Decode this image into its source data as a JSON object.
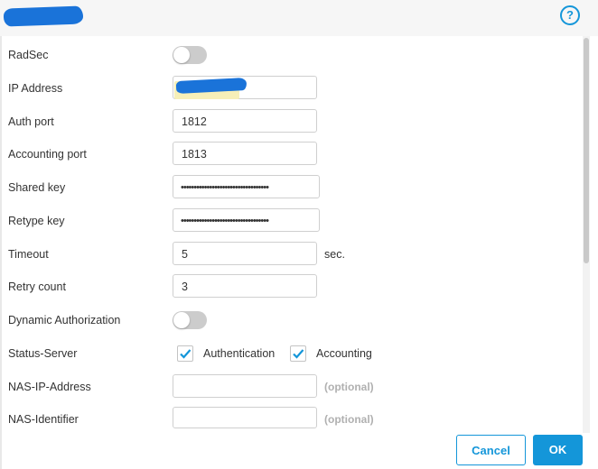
{
  "header": {
    "help_icon": "help-icon",
    "help_glyph": "?"
  },
  "form": {
    "radsec": {
      "label": "RadSec",
      "enabled": false
    },
    "ip_address": {
      "label": "IP Address",
      "value": ""
    },
    "auth_port": {
      "label": "Auth port",
      "value": "1812"
    },
    "accounting_port": {
      "label": "Accounting port",
      "value": "1813"
    },
    "shared_key": {
      "label": "Shared key",
      "value": "••••••••••••••••••••••••••••••••••"
    },
    "retype_key": {
      "label": "Retype key",
      "value": "••••••••••••••••••••••••••••••••••"
    },
    "timeout": {
      "label": "Timeout",
      "value": "5",
      "unit": "sec."
    },
    "retry_count": {
      "label": "Retry count",
      "value": "3"
    },
    "dynamic_authorization": {
      "label": "Dynamic Authorization",
      "enabled": false
    },
    "status_server": {
      "label": "Status-Server",
      "authentication": {
        "label": "Authentication",
        "checked": true
      },
      "accounting": {
        "label": "Accounting",
        "checked": true
      }
    },
    "nas_ip_address": {
      "label": "NAS-IP-Address",
      "value": "",
      "hint": "(optional)"
    },
    "nas_identifier": {
      "label": "NAS-Identifier",
      "value": "",
      "hint": "(optional)"
    }
  },
  "footer": {
    "cancel_label": "Cancel",
    "ok_label": "OK"
  },
  "colors": {
    "accent": "#1496d9",
    "toggle_off": "#cccccc",
    "hint": "#b0b0b0"
  }
}
